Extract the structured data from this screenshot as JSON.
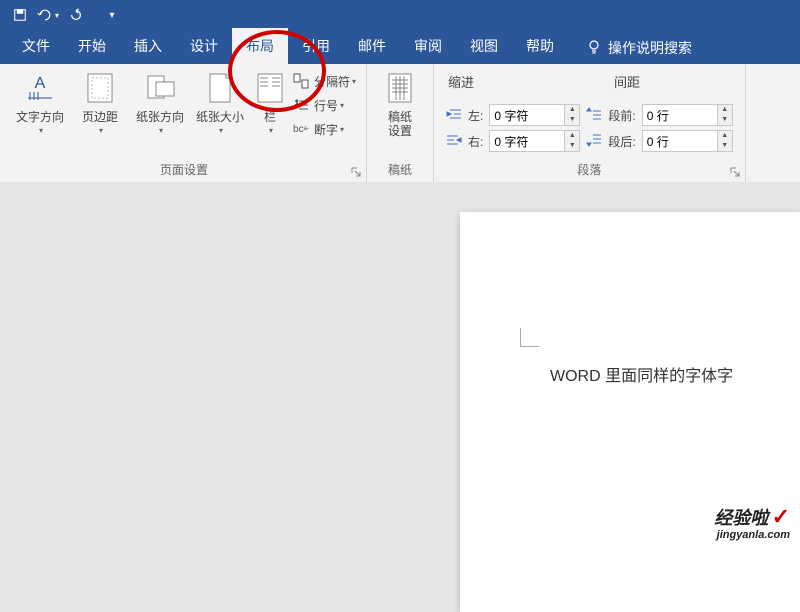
{
  "qat": {
    "save": "",
    "undo": "",
    "redo": ""
  },
  "tabs": {
    "file": "文件",
    "home": "开始",
    "insert": "插入",
    "design": "设计",
    "layout": "布局",
    "references": "引用",
    "mail": "邮件",
    "review": "审阅",
    "view": "视图",
    "help": "帮助",
    "tellme": "操作说明搜索"
  },
  "ribbon": {
    "pageSetup": {
      "textDirection": "文字方向",
      "margins": "页边距",
      "orientation": "纸张方向",
      "size": "纸张大小",
      "columns": "栏",
      "breaks": "分隔符",
      "lineNumbers": "行号",
      "hyphenation": "断字",
      "label": "页面设置"
    },
    "manuscript": {
      "btn": "稿纸\n设置",
      "label": "稿纸"
    },
    "paragraph": {
      "indentHdr": "缩进",
      "spacingHdr": "间距",
      "leftLbl": "左:",
      "rightLbl": "右:",
      "beforeLbl": "段前:",
      "afterLbl": "段后:",
      "leftVal": "0 字符",
      "rightVal": "0 字符",
      "beforeVal": "0 行",
      "afterVal": "0 行",
      "label": "段落"
    }
  },
  "document": {
    "text": "WORD 里面同样的字体字"
  },
  "watermark": {
    "brand": "经验啦",
    "url": "jingyanla.com"
  }
}
